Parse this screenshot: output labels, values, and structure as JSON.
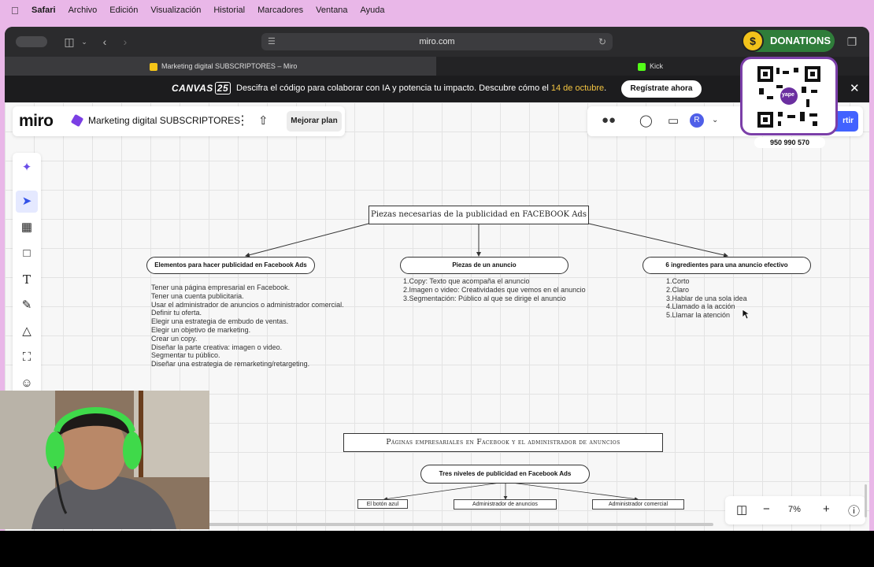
{
  "menubar": {
    "app": "Safari",
    "items": [
      "Archivo",
      "Edición",
      "Visualización",
      "Historial",
      "Marcadores",
      "Ventana",
      "Ayuda"
    ]
  },
  "browser": {
    "url": "miro.com",
    "tabs": [
      {
        "label": "Marketing digital SUBSCRIPTORES – Miro",
        "active": true,
        "favicon_color": "#f5c518"
      },
      {
        "label": "Kick",
        "active": false,
        "favicon_color": "#53fc18"
      }
    ]
  },
  "banner": {
    "logo_text": "CANVAS",
    "logo_num": "25",
    "message": "Descifra el código para colaborar con IA y potencia tu impacto. Descubre cómo el ",
    "date": "14 de octubre",
    "message_end": ".",
    "cta": "Regístrate ahora"
  },
  "miro": {
    "brand": "miro",
    "board_name": "Marketing digital SUBSCRIPTORES",
    "upgrade": "Mejorar plan",
    "avatar_initial": "R",
    "share_label": "rtir",
    "zoom": "7%"
  },
  "diagram": {
    "main_title": "Piezas necesarias de la publicidad en FACEBOOK Ads",
    "branches": [
      {
        "title": "Elementos para hacer publicidad en Facebook Ads",
        "lines": [
          "Tener una página empresarial en Facebook.",
          "Tener una cuenta publicitaria.",
          "Usar el administrador de anuncios o administrador comercial.",
          "Definir tu oferta.",
          "Elegir una estrategia de embudo de ventas.",
          "Elegir un objetivo de marketing.",
          "Crear un copy.",
          "Diseñar la parte creativa: imagen o video.",
          "Segmentar tu público.",
          "Diseñar una estrategia de remarketing/retargeting."
        ]
      },
      {
        "title": "Piezas de un anuncio",
        "lines": [
          "1.Copy: Texto que acompaña el anuncio",
          "2.Imagen o video: Creatividades que vemos en el anuncio",
          "3.Segmentación: Público al que se dirige el anuncio"
        ]
      },
      {
        "title": "6 ingredientes para una anuncio efectivo",
        "lines": [
          "1.Corto",
          "2.Claro",
          "3.Hablar de una sola idea",
          "4.Llamado a la acción",
          "5.Llamar la atención"
        ]
      }
    ],
    "second_title": "Páginas empresariales en Facebook y el administrador de anuncios",
    "levels_title": "Tres niveles de publicidad en Facebook Ads",
    "levels": [
      "El botón azul",
      "Administrador de anuncios",
      "Administrador comercial"
    ]
  },
  "overlay": {
    "donations": "DONATIONS",
    "coin": "$",
    "qr_caption": "yape",
    "phone": "950 990 570"
  }
}
